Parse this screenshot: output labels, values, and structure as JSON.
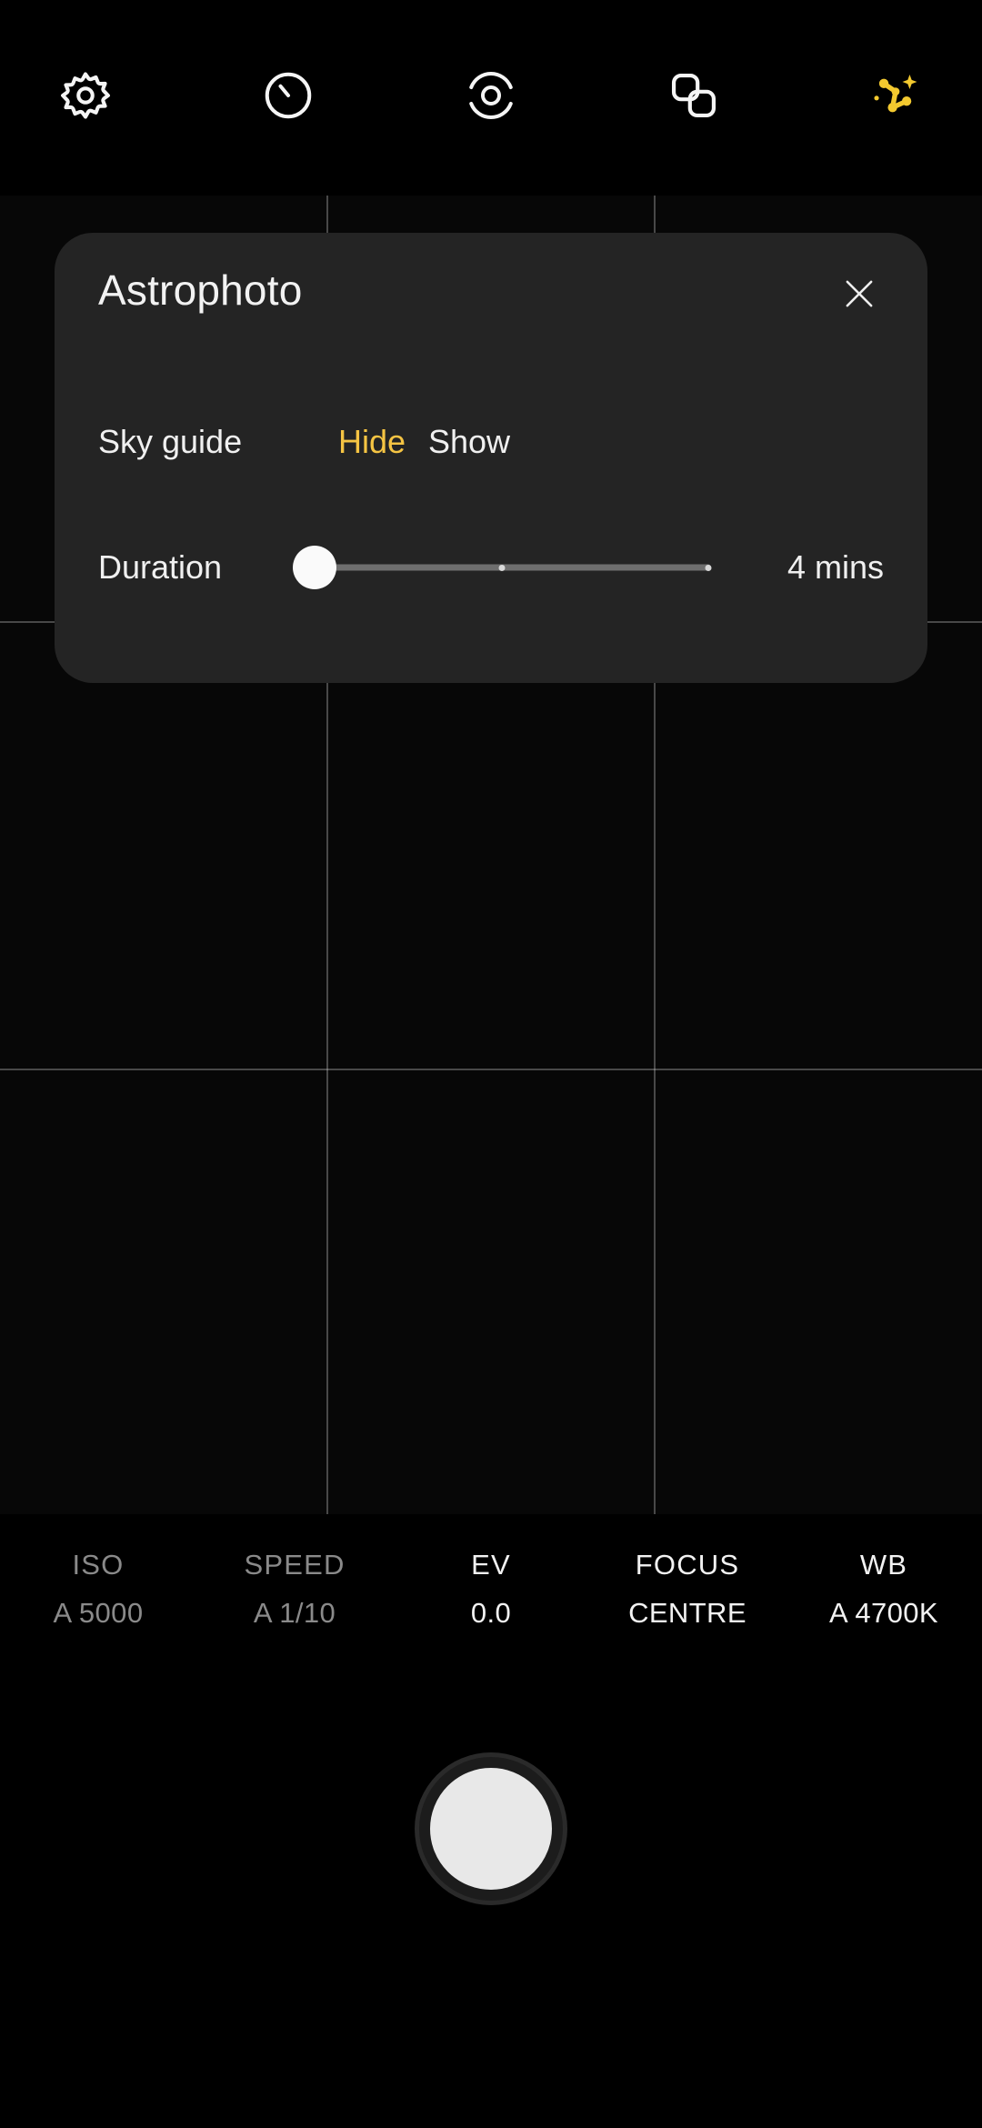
{
  "toolbar": {
    "items": [
      {
        "name": "settings-icon",
        "label": "Settings"
      },
      {
        "name": "timer-icon",
        "label": "Timer"
      },
      {
        "name": "motion-photo-icon",
        "label": "Motion photo"
      },
      {
        "name": "multi-frame-icon",
        "label": "Multi frame"
      },
      {
        "name": "astrophoto-icon",
        "label": "Astrophoto"
      }
    ]
  },
  "panel": {
    "title": "Astrophoto",
    "close_label": "Close",
    "sky_guide": {
      "label": "Sky guide",
      "options": [
        "Hide",
        "Show"
      ],
      "hide_label": "Hide",
      "show_label": "Show",
      "selected": "Hide"
    },
    "duration": {
      "label": "Duration",
      "value": "4 mins",
      "slider_position_percent": 0,
      "tick_positions_percent": [
        45,
        99
      ]
    }
  },
  "info_bar": {
    "columns": [
      {
        "key": "ISO",
        "value": "A 5000",
        "state": "dim"
      },
      {
        "key": "SPEED",
        "value": "A 1/10",
        "state": "dim"
      },
      {
        "key": "EV",
        "value": "0.0",
        "state": "bright"
      },
      {
        "key": "FOCUS",
        "value": "CENTRE",
        "state": "bright"
      },
      {
        "key": "WB",
        "value": "A 4700K",
        "state": "bright"
      }
    ]
  },
  "shutter": {
    "label": "Capture"
  },
  "colors": {
    "accent": "#f5c443",
    "panel_bg": "#242424",
    "background": "#000000",
    "text": "#f0f0f0",
    "text_dim": "#8a8a8a"
  },
  "viewfinder": {
    "grid": "3x3"
  }
}
